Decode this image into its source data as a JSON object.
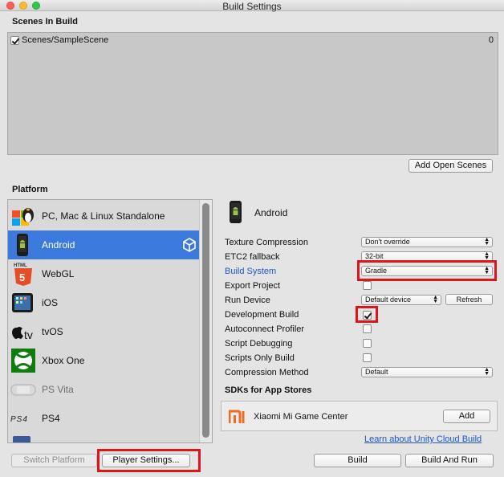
{
  "window": {
    "title": "Build Settings"
  },
  "scenes": {
    "heading": "Scenes In Build",
    "items": [
      {
        "name": "Scenes/SampleScene",
        "index": "0",
        "checked": true
      }
    ],
    "add_open_scenes_label": "Add Open Scenes"
  },
  "platform": {
    "heading": "Platform",
    "items": [
      {
        "label": "PC, Mac & Linux Standalone",
        "icon": "pc-mac-linux-icon",
        "selected": false
      },
      {
        "label": "Android",
        "icon": "android-icon",
        "selected": true
      },
      {
        "label": "WebGL",
        "icon": "html5-icon",
        "selected": false
      },
      {
        "label": "iOS",
        "icon": "ios-device-icon",
        "selected": false
      },
      {
        "label": "tvOS",
        "icon": "apple-tv-icon",
        "selected": false
      },
      {
        "label": "Xbox One",
        "icon": "xbox-icon",
        "selected": false
      },
      {
        "label": "PS Vita",
        "icon": "ps-vita-icon",
        "selected": false,
        "dim": true
      },
      {
        "label": "PS4",
        "icon": "ps4-icon",
        "selected": false
      }
    ]
  },
  "settings": {
    "platform_title": "Android",
    "texture_compression": {
      "label": "Texture Compression",
      "value": "Don't override"
    },
    "etc2_fallback": {
      "label": "ETC2 fallback",
      "value": "32-bit"
    },
    "build_system": {
      "label": "Build System",
      "value": "Gradle"
    },
    "export_project": {
      "label": "Export Project",
      "checked": false
    },
    "run_device": {
      "label": "Run Device",
      "value": "Default device",
      "refresh_label": "Refresh"
    },
    "development_build": {
      "label": "Development Build",
      "checked": true
    },
    "autoconnect_profiler": {
      "label": "Autoconnect Profiler",
      "checked": false
    },
    "script_debugging": {
      "label": "Script Debugging",
      "checked": false
    },
    "scripts_only_build": {
      "label": "Scripts Only Build",
      "checked": false
    },
    "compression_method": {
      "label": "Compression Method",
      "value": "Default"
    }
  },
  "sdks": {
    "heading": "SDKs for App Stores",
    "items": [
      {
        "name": "Xiaomi Mi Game Center",
        "add_label": "Add"
      }
    ],
    "cloud_build_link": "Learn about Unity Cloud Build"
  },
  "footer": {
    "switch_platform_label": "Switch Platform",
    "player_settings_label": "Player Settings...",
    "build_label": "Build",
    "build_and_run_label": "Build And Run"
  },
  "colors": {
    "selection": "#3b79dd",
    "highlight_box": "#e0141b",
    "link": "#1e56c8"
  }
}
